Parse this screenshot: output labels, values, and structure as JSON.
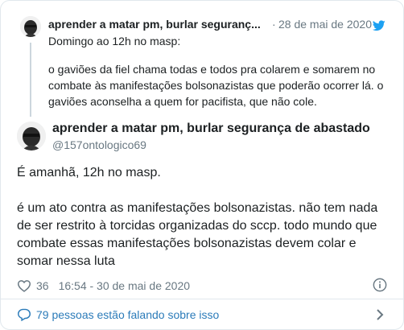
{
  "quoted": {
    "name": "aprender a matar pm, burlar seguranç...",
    "separator": "·",
    "date": "28 de mai de 2020",
    "paragraphs": [
      "Domingo ao 12h no masp:",
      "o gaviões da fiel chama todas e todos pra colarem e somarem no combate às manifestações bolsonazistas que poderão ocorrer lá. o gaviões aconselha a quem for pacifista, que não cole."
    ]
  },
  "tweet": {
    "name": "aprender a matar pm, burlar segurança de abastado",
    "handle": "@157ontologico69",
    "paragraphs": [
      "É amanhã, 12h no masp.",
      "é um ato contra as manifestações bolsonazistas. não tem nada de ser restrito à torcidas organizadas do sccp. todo mundo que combate essas manifestações bolsonazistas devem colar e somar nessa luta"
    ],
    "likes": "36",
    "timestamp": "16:54 - 30 de mai de 2020"
  },
  "footer": {
    "conversation_text": "79 pessoas estão falando sobre isso"
  },
  "colors": {
    "text": "#1c2022",
    "muted": "#697882",
    "link": "#2b7bb9",
    "twitter_blue": "#1da1f2",
    "border": "#e1e8ed"
  },
  "icons": {
    "brand": "twitter-bird-icon",
    "like": "heart-icon",
    "info": "info-icon",
    "reply": "speech-bubble-icon",
    "more": "chevron-right-icon"
  }
}
